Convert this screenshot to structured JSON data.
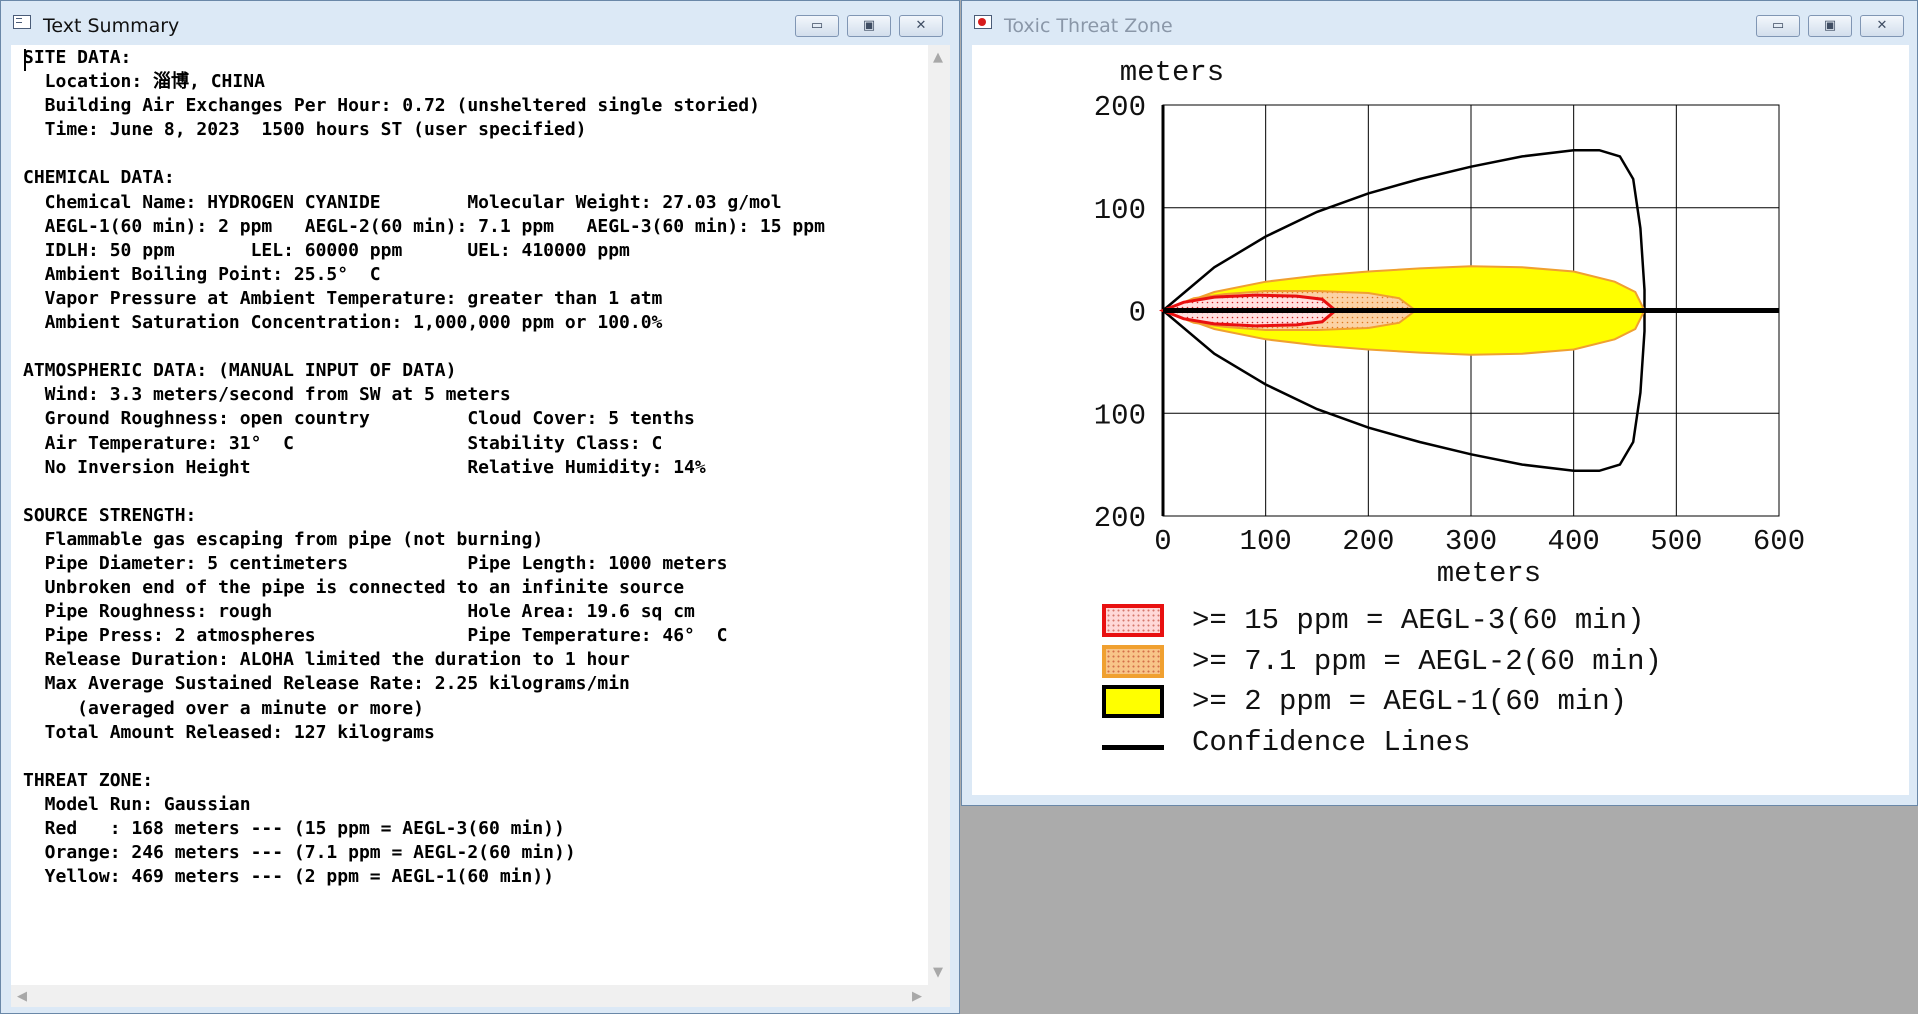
{
  "text_window": {
    "title": "Text Summary",
    "icon": "document-window-icon",
    "lines": [
      "SITE DATA:",
      "  Location: 淄博, CHINA",
      "  Building Air Exchanges Per Hour: 0.72 (unsheltered single storied)",
      "  Time: June 8, 2023  1500 hours ST (user specified)",
      "",
      "CHEMICAL DATA:",
      "  Chemical Name: HYDROGEN CYANIDE        Molecular Weight: 27.03 g/mol",
      "  AEGL-1(60 min): 2 ppm   AEGL-2(60 min): 7.1 ppm   AEGL-3(60 min): 15 ppm",
      "  IDLH: 50 ppm       LEL: 60000 ppm      UEL: 410000 ppm",
      "  Ambient Boiling Point: 25.5°  C",
      "  Vapor Pressure at Ambient Temperature: greater than 1 atm",
      "  Ambient Saturation Concentration: 1,000,000 ppm or 100.0%",
      "",
      "ATMOSPHERIC DATA: (MANUAL INPUT OF DATA)",
      "  Wind: 3.3 meters/second from SW at 5 meters",
      "  Ground Roughness: open country         Cloud Cover: 5 tenths",
      "  Air Temperature: 31°  C                Stability Class: C",
      "  No Inversion Height                    Relative Humidity: 14%",
      "",
      "SOURCE STRENGTH:",
      "  Flammable gas escaping from pipe (not burning)",
      "  Pipe Diameter: 5 centimeters           Pipe Length: 1000 meters",
      "  Unbroken end of the pipe is connected to an infinite source",
      "  Pipe Roughness: rough                  Hole Area: 19.6 sq cm",
      "  Pipe Press: 2 atmospheres              Pipe Temperature: 46°  C",
      "  Release Duration: ALOHA limited the duration to 1 hour",
      "  Max Average Sustained Release Rate: 2.25 kilograms/min",
      "     (averaged over a minute or more)",
      "  Total Amount Released: 127 kilograms",
      "",
      "THREAT ZONE:",
      "  Model Run: Gaussian",
      "  Red   : 168 meters --- (15 ppm = AEGL-3(60 min))",
      "  Orange: 246 meters --- (7.1 ppm = AEGL-2(60 min))",
      "  Yellow: 469 meters --- (2 ppm = AEGL-1(60 min))"
    ]
  },
  "plot_window": {
    "title": "Toxic Threat Zone",
    "icon": "threat-zone-window-icon"
  },
  "window_buttons": {
    "minimize": "▭",
    "maximize": "▣",
    "close": "✕"
  },
  "chart_data": {
    "type": "area",
    "title": "",
    "ylabel": "meters",
    "xlabel": "meters",
    "xlim": [
      0,
      600
    ],
    "ylim": [
      -200,
      200
    ],
    "x_ticks": [
      0,
      100,
      200,
      300,
      400,
      500,
      600
    ],
    "x_tick_labels": [
      "0",
      "100",
      "200",
      "300",
      "400",
      "500",
      "600"
    ],
    "y_ticks": [
      200,
      100,
      0,
      -100,
      -200
    ],
    "y_tick_labels": [
      "200",
      "100",
      "0",
      "100",
      "200"
    ],
    "grid": true,
    "centerline": {
      "from_x": 0,
      "to_x": 600,
      "y": 0
    },
    "zones": [
      {
        "name": "AEGL-1",
        "fill": "#ffff00",
        "stroke": "#f0a030",
        "upper": [
          [
            0,
            0
          ],
          [
            50,
            18
          ],
          [
            100,
            28
          ],
          [
            150,
            34
          ],
          [
            200,
            38
          ],
          [
            250,
            41
          ],
          [
            300,
            43
          ],
          [
            350,
            42
          ],
          [
            400,
            38
          ],
          [
            440,
            28
          ],
          [
            460,
            18
          ],
          [
            469,
            0
          ]
        ]
      },
      {
        "name": "AEGL-2",
        "fill": "#f8d4a8",
        "stroke": "#f0a030",
        "upper": [
          [
            0,
            0
          ],
          [
            30,
            12
          ],
          [
            60,
            16
          ],
          [
            100,
            19
          ],
          [
            150,
            19
          ],
          [
            200,
            17
          ],
          [
            230,
            12
          ],
          [
            246,
            0
          ]
        ]
      },
      {
        "name": "AEGL-3",
        "fill": "#ffd8d8",
        "stroke": "#e81010",
        "upper": [
          [
            0,
            0
          ],
          [
            20,
            8
          ],
          [
            50,
            13
          ],
          [
            90,
            15
          ],
          [
            130,
            14
          ],
          [
            155,
            11
          ],
          [
            168,
            0
          ]
        ]
      }
    ],
    "confidence_lines": {
      "color": "#000000",
      "upper": [
        [
          0,
          0
        ],
        [
          50,
          42
        ],
        [
          100,
          72
        ],
        [
          150,
          96
        ],
        [
          200,
          114
        ],
        [
          250,
          128
        ],
        [
          300,
          140
        ],
        [
          350,
          150
        ],
        [
          400,
          156
        ],
        [
          425,
          156
        ],
        [
          445,
          150
        ],
        [
          458,
          128
        ],
        [
          465,
          80
        ],
        [
          469,
          20
        ],
        [
          469,
          0
        ]
      ]
    },
    "legend": [
      {
        "label": ">= 15 ppm = AEGL-3(60 min)",
        "fill": "#ffd8d8",
        "border": "#e81010",
        "pattern": "dots"
      },
      {
        "label": ">= 7.1 ppm = AEGL-2(60 min)",
        "fill": "#f8c488",
        "border": "#f0a030",
        "pattern": "dots"
      },
      {
        "label": ">= 2 ppm = AEGL-1(60 min)",
        "fill": "#ffff00",
        "border": "#000000",
        "pattern": "solid"
      },
      {
        "label": "Confidence Lines",
        "fill": "none",
        "border": "#000000",
        "pattern": "line"
      }
    ]
  }
}
